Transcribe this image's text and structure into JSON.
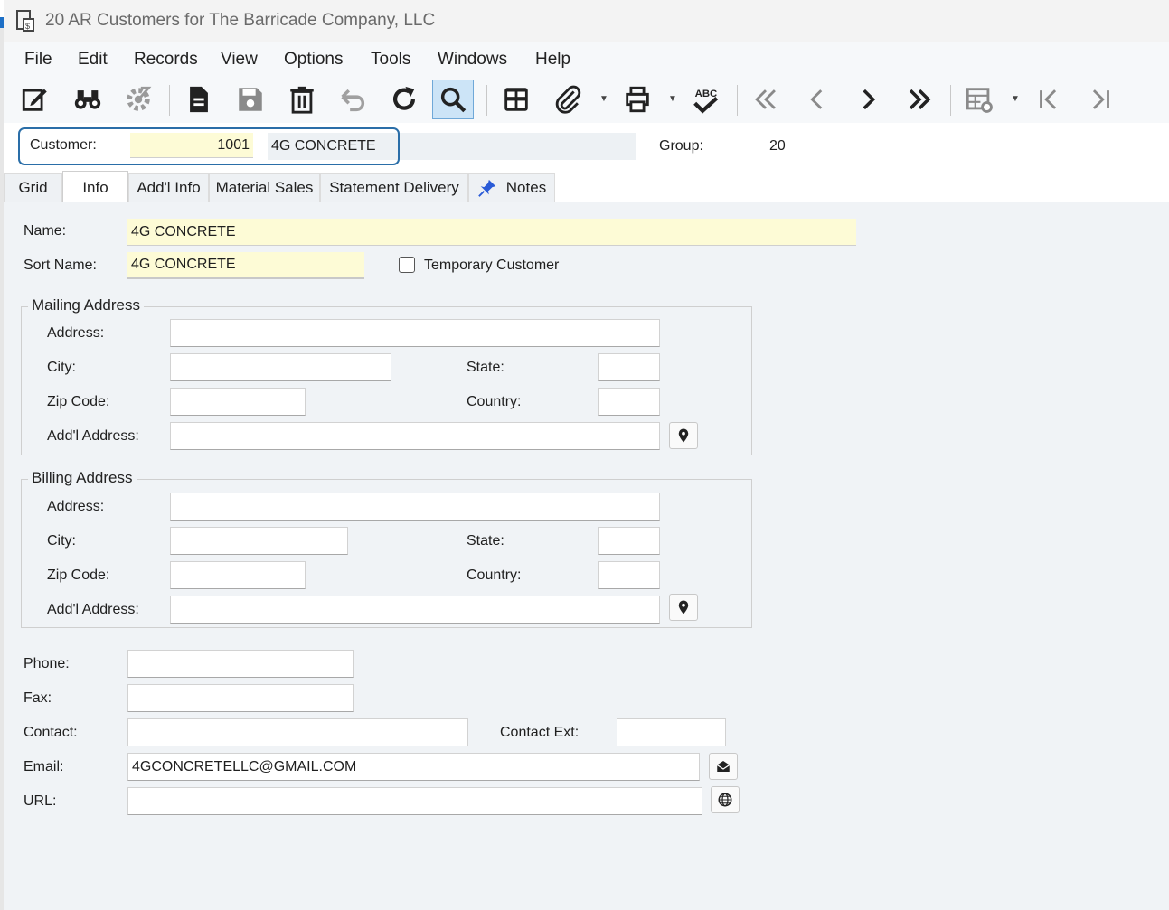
{
  "window": {
    "title": "20 AR Customers for The Barricade Company, LLC"
  },
  "menu": [
    "File",
    "Edit",
    "Records",
    "View",
    "Options",
    "Tools",
    "Windows",
    "Help"
  ],
  "header": {
    "customer_label": "Customer:",
    "customer_number": "1001",
    "customer_name": "4G CONCRETE",
    "group_label": "Group:",
    "group_value": "20"
  },
  "tabs": [
    "Grid",
    "Info",
    "Add'l Info",
    "Material Sales",
    "Statement Delivery",
    "Notes"
  ],
  "active_tab": "Info",
  "info": {
    "name_label": "Name:",
    "name_value": "4G CONCRETE",
    "sort_name_label": "Sort Name:",
    "sort_name_value": "4G CONCRETE",
    "temporary_label": "Temporary Customer",
    "temporary_checked": false
  },
  "mailing": {
    "title": "Mailing Address",
    "address_label": "Address:",
    "city_label": "City:",
    "state_label": "State:",
    "zip_label": "Zip Code:",
    "country_label": "Country:",
    "addl_label": "Add'l Address:",
    "address": "",
    "city": "",
    "state": "",
    "zip": "",
    "country": "",
    "addl": ""
  },
  "billing": {
    "title": "Billing Address",
    "address_label": "Address:",
    "city_label": "City:",
    "state_label": "State:",
    "zip_label": "Zip Code:",
    "country_label": "Country:",
    "addl_label": "Add'l Address:",
    "address": "",
    "city": "",
    "state": "",
    "zip": "",
    "country": "",
    "addl": ""
  },
  "contact": {
    "phone_label": "Phone:",
    "fax_label": "Fax:",
    "contact_label": "Contact:",
    "contact_ext_label": "Contact Ext:",
    "email_label": "Email:",
    "email_value": "4GCONCRETELLC@GMAIL.COM",
    "url_label": "URL:",
    "phone": "",
    "fax": "",
    "contact": "",
    "contact_ext": "",
    "url": ""
  },
  "toolbar_icons": [
    "edit-icon",
    "find-binoculars-icon",
    "settings-icon",
    "new-document-icon",
    "save-icon",
    "delete-icon",
    "undo-icon",
    "refresh-icon",
    "search-icon",
    "grid-layout-icon",
    "attach-icon",
    "print-icon",
    "spellcheck-icon",
    "first-record-icon",
    "previous-record-icon",
    "next-record-icon",
    "last-record-icon",
    "table-settings-icon",
    "jump-first-icon",
    "jump-last-icon"
  ],
  "colors": {
    "accent": "#2a6ea8",
    "required_field": "#fdfbd6",
    "panel": "#f0f3f6",
    "active_tool": "#cce4f7"
  }
}
